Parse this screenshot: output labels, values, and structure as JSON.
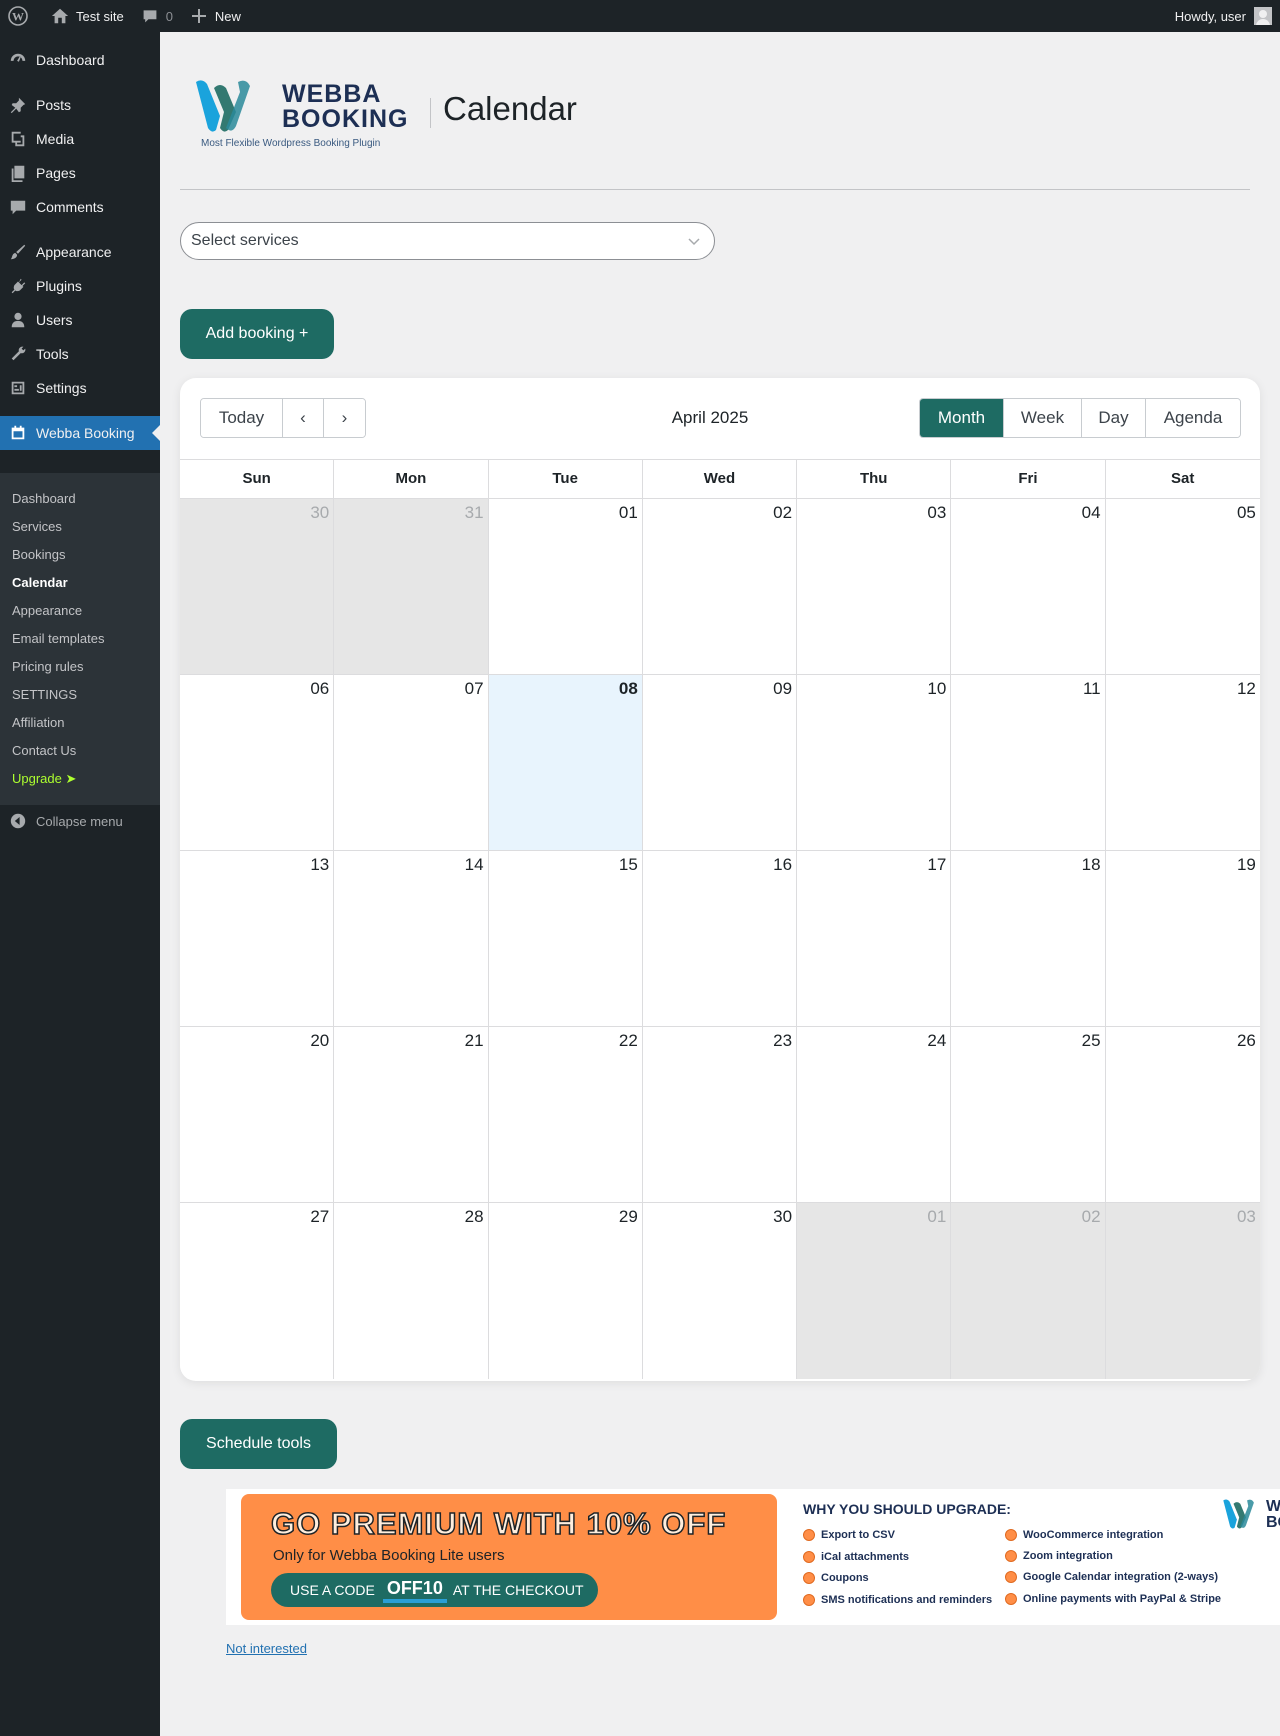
{
  "adminbar": {
    "site_name": "Test site",
    "comments_count": "0",
    "new_label": "New",
    "howdy": "Howdy, user"
  },
  "sidebar": {
    "items": [
      {
        "label": "Dashboard",
        "icon": "dashboard-icon"
      },
      {
        "label": "Posts",
        "icon": "pin-icon"
      },
      {
        "label": "Media",
        "icon": "media-icon"
      },
      {
        "label": "Pages",
        "icon": "pages-icon"
      },
      {
        "label": "Comments",
        "icon": "comment-icon"
      },
      {
        "label": "Appearance",
        "icon": "brush-icon"
      },
      {
        "label": "Plugins",
        "icon": "plugin-icon"
      },
      {
        "label": "Users",
        "icon": "user-icon"
      },
      {
        "label": "Tools",
        "icon": "wrench-icon"
      },
      {
        "label": "Settings",
        "icon": "settings-icon"
      },
      {
        "label": "Webba Booking",
        "icon": "calendar-icon"
      }
    ],
    "submenu": [
      "Dashboard",
      "Services",
      "Bookings",
      "Calendar",
      "Appearance",
      "Email templates",
      "Pricing rules",
      "SETTINGS",
      "Affiliation",
      "Contact Us",
      "Upgrade ➤"
    ],
    "current_submenu": "Calendar",
    "collapse_label": "Collapse menu"
  },
  "header": {
    "logo_line1": "WEBBA",
    "logo_line2": "BOOKING",
    "logo_tagline": "Most Flexible Wordpress Booking Plugin",
    "title": "Calendar"
  },
  "filters": {
    "services_placeholder": "Select services"
  },
  "buttons": {
    "add_booking": "Add booking +",
    "schedule_tools": "Schedule tools"
  },
  "calendar": {
    "today_label": "Today",
    "prev_label": "‹",
    "next_label": "›",
    "period_label": "April 2025",
    "views": [
      "Month",
      "Week",
      "Day",
      "Agenda"
    ],
    "active_view": "Month",
    "weekdays": [
      "Sun",
      "Mon",
      "Tue",
      "Wed",
      "Thu",
      "Fri",
      "Sat"
    ],
    "weeks": [
      [
        "30",
        "31",
        "01",
        "02",
        "03",
        "04",
        "05"
      ],
      [
        "06",
        "07",
        "08",
        "09",
        "10",
        "11",
        "12"
      ],
      [
        "13",
        "14",
        "15",
        "16",
        "17",
        "18",
        "19"
      ],
      [
        "20",
        "21",
        "22",
        "23",
        "24",
        "25",
        "26"
      ],
      [
        "27",
        "28",
        "29",
        "30",
        "01",
        "02",
        "03"
      ]
    ],
    "today": "08"
  },
  "promo": {
    "headline": "GO PREMIUM WITH 10% OFF",
    "subline": "Only for Webba Booking Lite users",
    "code_prefix": "USE A CODE",
    "code": "OFF10",
    "code_suffix": "AT THE CHECKOUT",
    "why_title": "WHY YOU SHOULD UPGRADE:",
    "features_left": [
      "Export to CSV",
      "iCal attachments",
      "Coupons",
      "SMS notifications and reminders"
    ],
    "features_right": [
      "WooCommerce integration",
      "Zoom integration",
      "Google Calendar integration (2-ways)",
      "Online payments with PayPal & Stripe"
    ],
    "logo_text_1": "WEB",
    "logo_text_2": "BOO",
    "not_interested": "Not interested"
  },
  "colors": {
    "accent": "#1e6b63",
    "wp_blue": "#2271b1",
    "promo_orange": "#ff8e47",
    "today_bg": "#e8f4fd"
  }
}
